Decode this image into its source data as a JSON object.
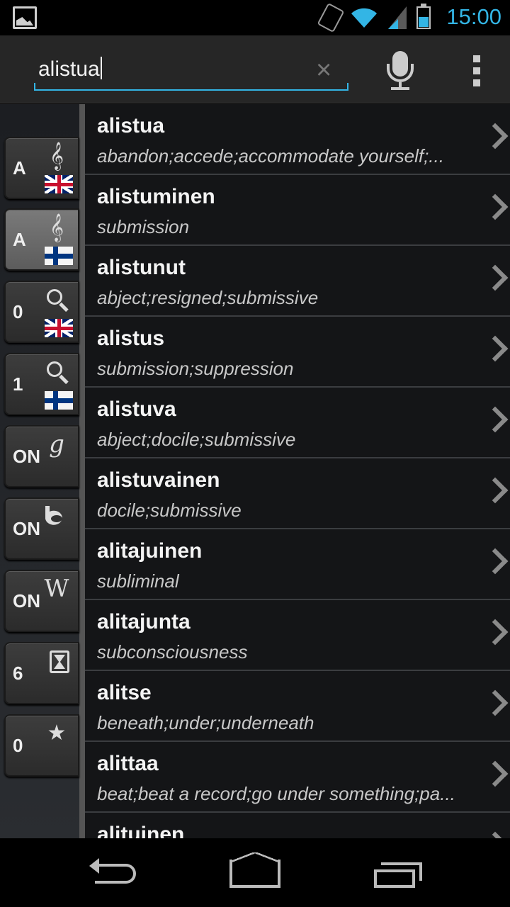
{
  "status_bar": {
    "time": "15:00",
    "icons": [
      "gallery-icon",
      "vibrate-icon",
      "wifi-icon",
      "signal-icon",
      "battery-icon"
    ],
    "accent": "#33b5e5"
  },
  "search": {
    "value": "alistua",
    "clear_glyph": "×"
  },
  "rail": {
    "buttons": [
      {
        "label": "A",
        "icon": "treble-clef-icon",
        "flag": "uk-flag-icon",
        "active": false
      },
      {
        "label": "A",
        "icon": "treble-clef-icon",
        "flag": "finland-flag-icon",
        "active": true
      },
      {
        "label": "0",
        "icon": "search-icon",
        "flag": "uk-flag-icon",
        "active": false
      },
      {
        "label": "1",
        "icon": "search-icon",
        "flag": "finland-flag-icon",
        "active": false
      },
      {
        "label": "ON",
        "icon": "google-icon",
        "glyph": "g"
      },
      {
        "label": "ON",
        "icon": "bing-icon",
        "glyph": "b"
      },
      {
        "label": "ON",
        "icon": "wikipedia-icon",
        "glyph": "W"
      },
      {
        "label": "6",
        "icon": "hourglass-icon"
      },
      {
        "label": "0",
        "icon": "star-icon",
        "glyph": "★"
      }
    ]
  },
  "results": [
    {
      "word": "alistua",
      "definition": "abandon;accede;accommodate yourself;..."
    },
    {
      "word": "alistuminen",
      "definition": "submission"
    },
    {
      "word": "alistunut",
      "definition": "abject;resigned;submissive"
    },
    {
      "word": "alistus",
      "definition": "submission;suppression"
    },
    {
      "word": "alistuva",
      "definition": "abject;docile;submissive"
    },
    {
      "word": "alistuvainen",
      "definition": "docile;submissive"
    },
    {
      "word": "alitajuinen",
      "definition": "subliminal"
    },
    {
      "word": "alitajunta",
      "definition": "subconsciousness"
    },
    {
      "word": "alitse",
      "definition": "beneath;under;underneath"
    },
    {
      "word": "alittaa",
      "definition": "beat;beat a record;go under something;pa..."
    },
    {
      "word": "alituinen",
      "definition": ""
    }
  ]
}
